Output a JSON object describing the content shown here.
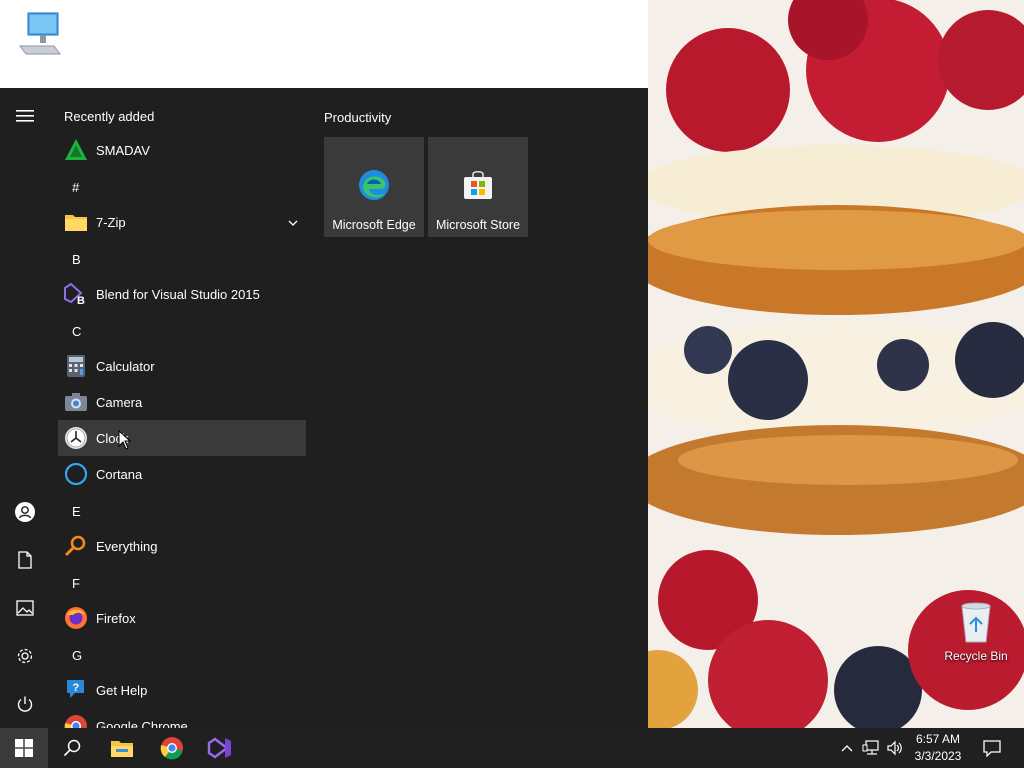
{
  "desktop": {
    "icons": [
      {
        "name": "this-pc",
        "label": ""
      },
      {
        "name": "recycle-bin",
        "label": "Recycle Bin"
      }
    ]
  },
  "start_menu": {
    "rail": [
      "menu-icon",
      "user-icon",
      "documents-icon",
      "pictures-icon",
      "settings-icon",
      "power-icon"
    ],
    "recently_added_header": "Recently added",
    "apps": {
      "smadav": "SMADAV",
      "hash": "#",
      "sevenzip": "7-Zip",
      "b": "B",
      "blend": "Blend for Visual Studio 2015",
      "c": "C",
      "calculator": "Calculator",
      "camera": "Camera",
      "clock": "Clock",
      "cortana": "Cortana",
      "e": "E",
      "everything": "Everything",
      "f": "F",
      "firefox": "Firefox",
      "g": "G",
      "gethelp": "Get Help",
      "chrome": "Google Chrome"
    },
    "tiles_group": "Productivity",
    "tiles": {
      "edge": "Microsoft Edge",
      "store": "Microsoft Store"
    }
  },
  "taskbar": {
    "pinned": [
      "start-icon",
      "search-icon",
      "file-explorer-icon",
      "chrome-icon",
      "visual-studio-icon"
    ],
    "time": "6:57 AM",
    "date": "3/3/2023"
  },
  "colors": {
    "start_bg": "#1f1f1f",
    "taskbar_bg": "#202020",
    "accent": "#0078d7"
  }
}
